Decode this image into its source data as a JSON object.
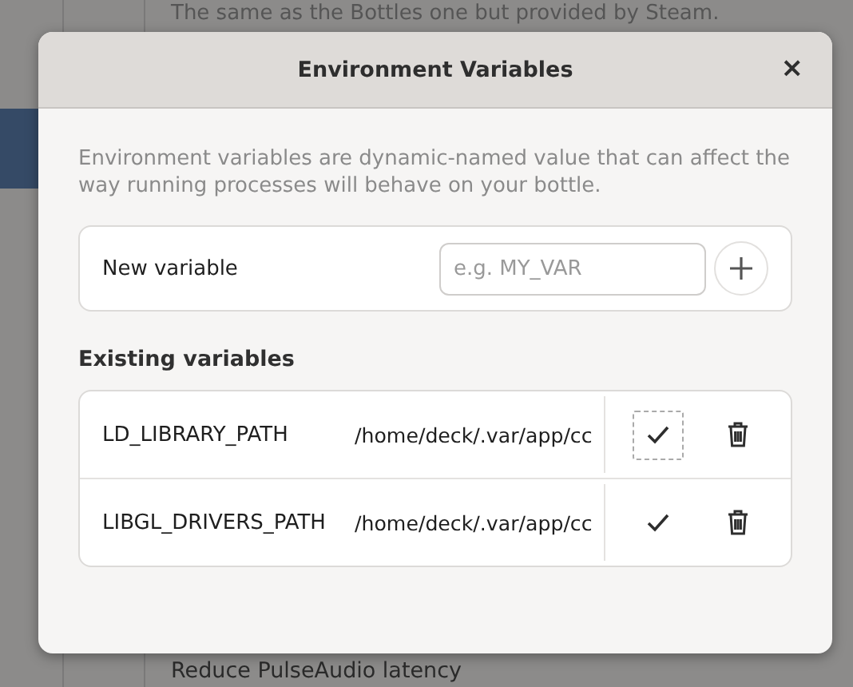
{
  "background": {
    "top_text": "The same as the Bottles one but provided by Steam.",
    "bottom_text": "Reduce PulseAudio latency"
  },
  "dialog": {
    "title": "Environment Variables",
    "close": "×",
    "description": "Environment variables are dynamic-named value that can affect the way running processes will behave on your bottle.",
    "new_variable": {
      "label": "New variable",
      "placeholder": "e.g. MY_VAR"
    },
    "section_title": "Existing variables",
    "variables": [
      {
        "name": "LD_LIBRARY_PATH",
        "value": "/home/deck/.var/app/cc",
        "focused": true
      },
      {
        "name": "LIBGL_DRIVERS_PATH",
        "value": "/home/deck/.var/app/cc",
        "focused": false
      }
    ]
  }
}
